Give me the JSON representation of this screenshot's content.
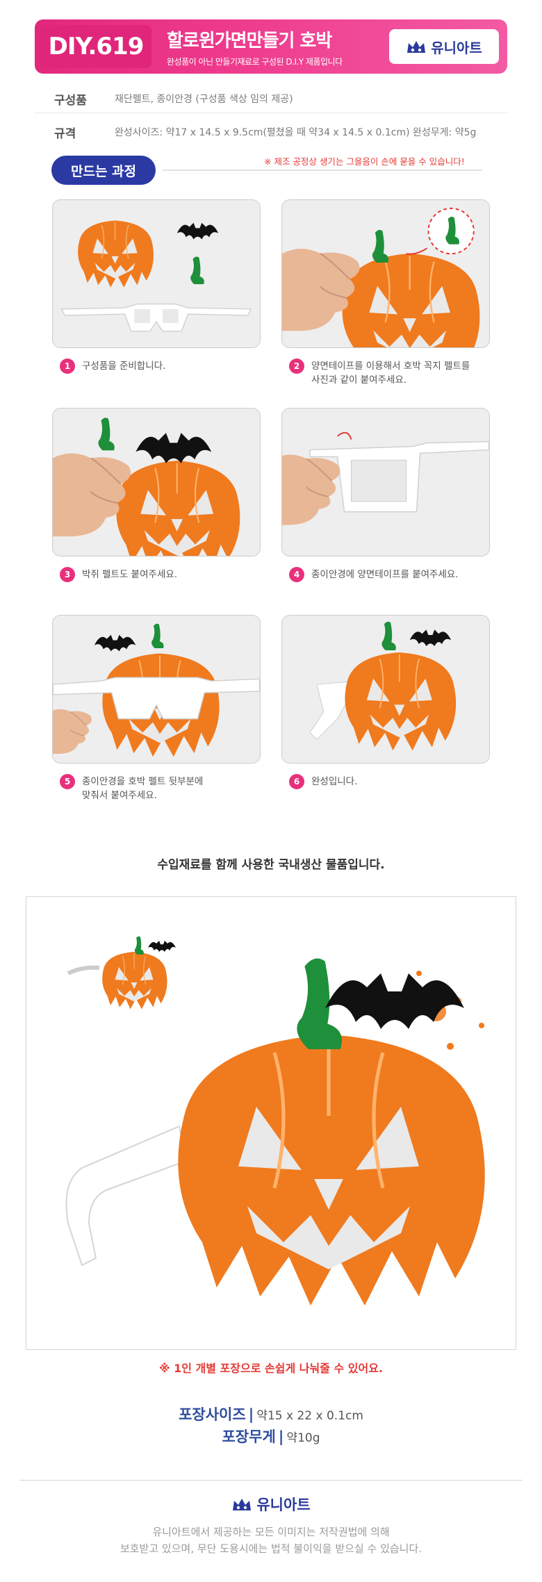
{
  "header": {
    "code": "DIY.619",
    "title": "할로윈가면만들기 호박",
    "subtitle": "완성품이 아닌 만들기재료로 구성된 D.I.Y 제품입니다",
    "brand": "유니아트"
  },
  "specs": {
    "components_label": "구성품",
    "components_value": "재단펠트, 종이안경 (구성품 색상 임의 제공)",
    "size_label": "규격",
    "size_value": "완성사이즈: 약17 x 14.5 x 9.5cm(펼쳤을 때 약34 x 14.5 x 0.1cm)   완성무게: 약5g"
  },
  "process": {
    "heading": "만드는 과정",
    "warning": "※ 제조 공정상 생기는 그을음이 손에 묻을 수 있습니다!",
    "steps": [
      {
        "num": "1",
        "text": "구성품을 준비합니다."
      },
      {
        "num": "2",
        "text": "양면테이프를 이용해서 호박 꼭지 펠트를\n사진과 같이 붙여주세요."
      },
      {
        "num": "3",
        "text": "박쥐 펠트도 붙여주세요."
      },
      {
        "num": "4",
        "text": "종이안경에 양면테이프를 붙여주세요."
      },
      {
        "num": "5",
        "text": "종이안경을 호박 펠트 뒷부분에\n맞춰서 붙여주세요."
      },
      {
        "num": "6",
        "text": "완성입니다."
      }
    ]
  },
  "import_note": "수입재료를 함께 사용한 국내생산 물품입니다.",
  "pack_note": "※ 1인 개별 포장으로 손쉽게 나눠줄 수 있어요.",
  "packaging": {
    "size_label": "포장사이즈",
    "size_value": "약15 x 22 x 0.1cm",
    "weight_label": "포장무게",
    "weight_value": "약10g"
  },
  "footer": {
    "brand": "유니아트",
    "line1": "유니아트에서 제공하는 모든 이미지는 저작권법에 의해",
    "line2": "보호받고 있으며, 무단 도용시에는 법적 불이익을 받으실 수 있습니다."
  },
  "colors": {
    "header_pink": "#e8307c",
    "brand_blue": "#2a3a9c",
    "warning_red": "#e53935",
    "pumpkin_orange": "#f07a1e"
  }
}
